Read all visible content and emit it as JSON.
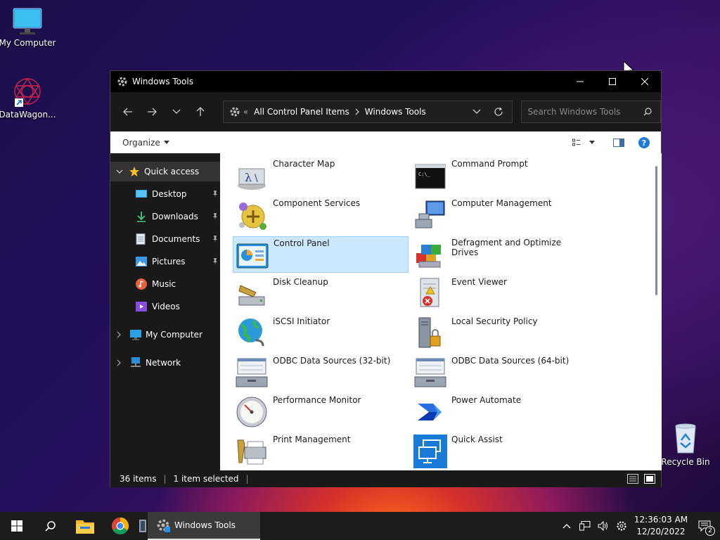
{
  "desktop": {
    "icons": [
      {
        "label": "My Computer",
        "icon": "monitor-icon"
      },
      {
        "label": "DataWagon...",
        "icon": "datawagon-shortcut-icon"
      },
      {
        "label": "Recycle Bin",
        "icon": "recycle-bin-icon"
      }
    ]
  },
  "window": {
    "title": "Windows Tools",
    "address": {
      "overflow": "«",
      "crumbs": [
        "All Control Panel Items",
        "Windows Tools"
      ]
    },
    "search_placeholder": "Search Windows Tools",
    "organize_label": "Organize"
  },
  "sidebar": {
    "quick_access": "Quick access",
    "pinned": [
      "Desktop",
      "Downloads",
      "Documents",
      "Pictures"
    ],
    "unpinned": [
      "Music",
      "Videos"
    ],
    "my_computer": "My Computer",
    "network": "Network"
  },
  "tools": [
    {
      "name": "Character Map",
      "icon": "character-map-icon"
    },
    {
      "name": "Command Prompt",
      "icon": "command-prompt-icon"
    },
    {
      "name": "Component Services",
      "icon": "component-services-icon"
    },
    {
      "name": "Computer Management",
      "icon": "computer-management-icon"
    },
    {
      "name": "Control Panel",
      "icon": "control-panel-icon",
      "selected": true
    },
    {
      "name": "Defragment and Optimize Drives",
      "icon": "defragment-icon"
    },
    {
      "name": "Disk Cleanup",
      "icon": "disk-cleanup-icon"
    },
    {
      "name": "Event Viewer",
      "icon": "event-viewer-icon"
    },
    {
      "name": "iSCSI Initiator",
      "icon": "iscsi-icon"
    },
    {
      "name": "Local Security Policy",
      "icon": "local-security-policy-icon"
    },
    {
      "name": "ODBC Data Sources (32-bit)",
      "icon": "odbc-32-icon"
    },
    {
      "name": "ODBC Data Sources (64-bit)",
      "icon": "odbc-64-icon"
    },
    {
      "name": "Performance Monitor",
      "icon": "performance-monitor-icon"
    },
    {
      "name": "Power Automate",
      "icon": "power-automate-icon"
    },
    {
      "name": "Print Management",
      "icon": "print-management-icon"
    },
    {
      "name": "Quick Assist",
      "icon": "quick-assist-icon"
    }
  ],
  "status": {
    "items": "36 items",
    "selected": "1 item selected"
  },
  "taskbar": {
    "active_window": "Windows Tools",
    "time": "12:36:03 AM",
    "date": "12/20/2022",
    "notification_count": "2"
  },
  "colors": {
    "accent": "#0078d4",
    "selection": "#cce8ff",
    "dark_chrome": "#191919"
  }
}
